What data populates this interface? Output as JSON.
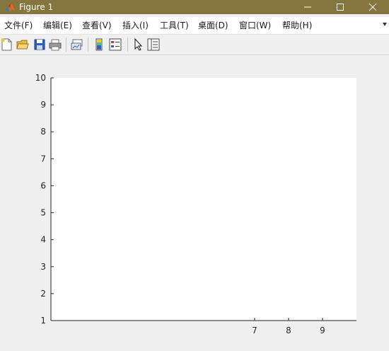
{
  "window": {
    "title": "Figure 1",
    "title_bar_color": "#85763f",
    "buttons": [
      "minimize-icon",
      "maximize-icon",
      "close-icon"
    ]
  },
  "menu": {
    "items": [
      {
        "label": "文件(F)"
      },
      {
        "label": "编辑(E)"
      },
      {
        "label": "查看(V)"
      },
      {
        "label": "插入(I)"
      },
      {
        "label": "工具(T)"
      },
      {
        "label": "桌面(D)"
      },
      {
        "label": "窗口(W)"
      },
      {
        "label": "帮助(H)"
      }
    ]
  },
  "toolbar": {
    "icons": [
      "new-figure-icon",
      "open-file-icon",
      "save-icon",
      "print-icon",
      "link-plot-icon",
      "colorbar-icon",
      "legend-icon",
      "edit-plot-pointer-icon",
      "property-inspector-icon"
    ]
  },
  "chart_data": {
    "type": "line",
    "title": "",
    "xlabel": "",
    "ylabel": "",
    "xlim": [
      1,
      10
    ],
    "ylim": [
      1,
      10
    ],
    "x_ticks": [
      7,
      8,
      9
    ],
    "y_ticks": [
      1,
      2,
      3,
      4,
      5,
      6,
      7,
      8,
      9,
      10
    ],
    "series": [],
    "grid": false
  }
}
